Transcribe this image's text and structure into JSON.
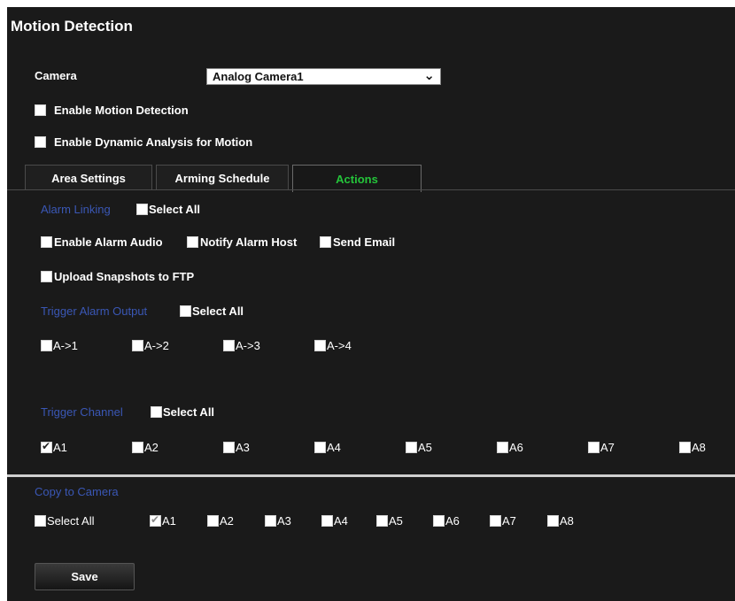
{
  "title": "Motion Detection",
  "camera": {
    "label": "Camera",
    "selected": "Analog Camera1"
  },
  "options": {
    "enable_motion": "Enable Motion Detection",
    "enable_dynamic": "Enable Dynamic Analysis for Motion"
  },
  "tabs": [
    {
      "label": "Area Settings",
      "active": false
    },
    {
      "label": "Arming Schedule",
      "active": false
    },
    {
      "label": "Actions",
      "active": true
    }
  ],
  "alarm_linking": {
    "title": "Alarm Linking",
    "select_all": "Select All",
    "items": [
      "Enable Alarm Audio",
      "Notify Alarm Host",
      "Send Email",
      "Upload Snapshots to FTP"
    ]
  },
  "trigger_alarm_output": {
    "title": "Trigger Alarm Output",
    "select_all": "Select All",
    "items": [
      "A->1",
      "A->2",
      "A->3",
      "A->4"
    ]
  },
  "trigger_channel": {
    "title": "Trigger Channel",
    "select_all": "Select All",
    "items": [
      "A1",
      "A2",
      "A3",
      "A4",
      "A5",
      "A6",
      "A7",
      "A8"
    ],
    "checked": [
      "A1"
    ]
  },
  "copy_to_camera": {
    "title": "Copy to Camera",
    "select_all": "Select All",
    "items": [
      "A1",
      "A2",
      "A3",
      "A4",
      "A5",
      "A6",
      "A7",
      "A8"
    ],
    "checked": [
      "A1"
    ]
  },
  "save_label": "Save",
  "colors": {
    "panel": "#1a1a1a",
    "section_title": "#3a57b5",
    "active_tab": "#24c43a"
  }
}
